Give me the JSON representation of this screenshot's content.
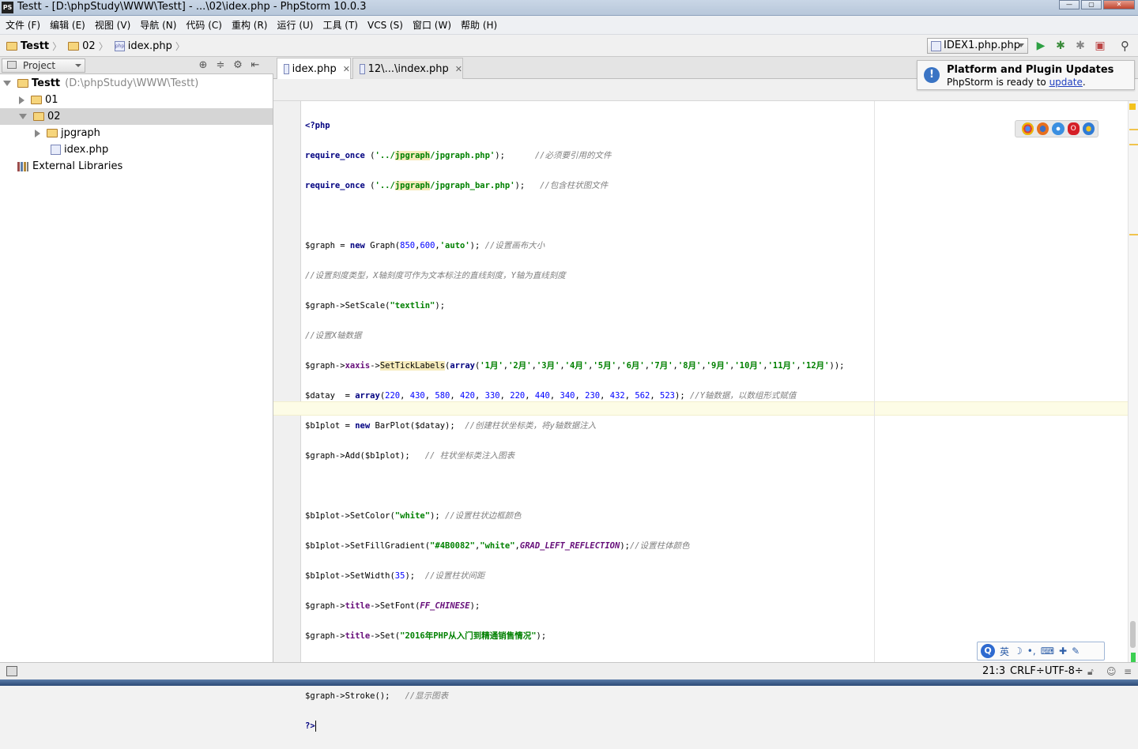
{
  "window": {
    "title": "Testt - [D:\\phpStudy\\WWW\\Testt] - ...\\02\\idex.php - PhpStorm 10.0.3",
    "app_badge": "PS"
  },
  "menu": [
    "文件 (F)",
    "编辑 (E)",
    "视图 (V)",
    "导航 (N)",
    "代码 (C)",
    "重构 (R)",
    "运行 (U)",
    "工具 (T)",
    "VCS (S)",
    "窗口 (W)",
    "帮助 (H)"
  ],
  "breadcrumb": [
    "Testt",
    "02",
    "idex.php"
  ],
  "run_config": "IDEX1.php.php",
  "project_panel": {
    "selector": "Project",
    "tree": [
      {
        "label": "Testt",
        "path": "(D:\\phpStudy\\WWW\\Testt)"
      },
      {
        "label": "01"
      },
      {
        "label": "02"
      },
      {
        "label": "jpgraph"
      },
      {
        "label": "idex.php"
      },
      {
        "label": "External Libraries"
      }
    ]
  },
  "tabs": [
    {
      "label": "idex.php",
      "active": true
    },
    {
      "label": "12\\...\\index.php",
      "active": false
    }
  ],
  "notification": {
    "title": "Platform and Plugin Updates",
    "body_prefix": "PhpStorm is ready to ",
    "link": "update",
    "body_suffix": "."
  },
  "status": {
    "position": "21:3",
    "line_sep": "CRLF÷",
    "encoding": "UTF-8÷"
  },
  "ime": {
    "lang": "英"
  },
  "colors": {
    "keyword": "#000080",
    "string": "#008000",
    "number": "#0000ff",
    "comment": "#808080",
    "constant": "#660e7a"
  }
}
